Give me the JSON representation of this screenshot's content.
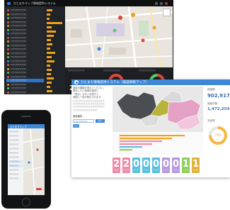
{
  "dashboard": {
    "title": "ひとまちマップ情報提供システム",
    "sidebar_items": [
      {
        "label": "○○○○○○○○",
        "color": "#e05a5a"
      },
      {
        "label": "○○○○○○○○",
        "color": "#f0a21d"
      },
      {
        "label": "○○○○○○○○",
        "color": "#5cc96a"
      },
      {
        "label": "○○○○○○○○",
        "color": "#e05a5a"
      },
      {
        "label": "○○○○○○○○",
        "color": "#f0a21d"
      },
      {
        "label": "○○○○○○○○",
        "color": "#5cc96a"
      },
      {
        "label": "○○○○○○○○",
        "color": "#3d86d8"
      },
      {
        "label": "○○○○○○○○",
        "color": "#e05a5a"
      },
      {
        "label": "○○○○○○○○",
        "color": "#f0a21d"
      },
      {
        "label": "○○○○○○○○",
        "color": "#5cc96a"
      },
      {
        "label": "○○○○○○○○",
        "color": "#e05a5a"
      },
      {
        "label": "○○○○○○○○",
        "color": "#f0a21d"
      },
      {
        "label": "○○○○○○○○",
        "color": "#5cc96a"
      },
      {
        "label": "○○○○○○○○",
        "color": "#3d86d8"
      },
      {
        "label": "○○○○○○○○",
        "color": "#e05a5a"
      },
      {
        "label": "○○○○○○○○",
        "color": "#f0a21d"
      },
      {
        "label": "○○○○○○○○",
        "color": "#5cc96a"
      },
      {
        "label": "○○○○○○○○",
        "color": "#e05a5a"
      },
      {
        "label": "○○○○○○○○",
        "color": "#3d86d8",
        "selected": true
      },
      {
        "label": "○○○○○○○○",
        "color": "#f0a21d"
      },
      {
        "label": "○○○○○○○○",
        "color": "#5cc96a"
      },
      {
        "label": "○○○○○○○○",
        "color": "#e05a5a"
      }
    ],
    "bar_values": [
      0.35,
      0.2,
      0.15,
      0.9,
      0.3,
      0.55,
      0.4,
      0.25,
      0.35,
      0.2,
      0.5,
      0.3,
      0.45,
      0.2,
      0.3,
      0.25,
      0.4,
      0.3,
      0.2,
      0.35
    ],
    "stat_labels": [
      "○○○○○○○○",
      "○○○○○○○○",
      "○○○○○○○○"
    ],
    "stat_value": "20"
  },
  "window": {
    "title": "ひとまち情報提供システム（施設情報マップ）",
    "intro_lines": [
      "施設の種類を選んでください。",
      "表示したい地域を選択し",
      "「表示」ボタンを押すと",
      "地図と一覧が表示されます。",
      "○○○○○○○○○○○○○○○○",
      "○○○○○○○○○○○○○○○○",
      "○○○○○○○○○○○○○○○○",
      "○○○○○○○○○○○○"
    ],
    "select_label": "施設種別",
    "select_value": "○○○○○○○",
    "search_button": "表示",
    "kpis": [
      {
        "label": "総面積",
        "value": "902,917"
      },
      {
        "label": "施設件数",
        "value": "1,472,254"
      }
    ],
    "donut_label": "充足率",
    "donut_value": "75%",
    "donut_fraction": 0.75,
    "tiles": [
      {
        "value": "2",
        "label": "○○○",
        "color": "#f08aa8"
      },
      {
        "value": "2",
        "label": "○○○",
        "color": "#f08aa8"
      },
      {
        "value": "0",
        "label": "○○○",
        "color": "#5bc0de"
      },
      {
        "value": "0",
        "label": "○○○",
        "color": "#5bc0de"
      },
      {
        "value": "0",
        "label": "○○○",
        "color": "#5bc0de"
      },
      {
        "value": "0",
        "label": "○○○",
        "color": "#b79ae0"
      },
      {
        "value": "0",
        "label": "○○○",
        "color": "#b79ae0"
      },
      {
        "value": "1",
        "label": "○○○",
        "color": "#8fcf5a"
      },
      {
        "value": "1",
        "label": "○○○",
        "color": "#e0b43c"
      }
    ]
  },
  "phone": {
    "title": "ひとまちマップ",
    "menu": [
      "○○○○○○",
      "○○○○○○",
      "○○○○○○",
      "○○○○○○",
      "○○○○○○",
      "○○○○○○",
      "○○○○○○",
      "○○○○○○",
      "○○○○○○",
      "○○○○○○",
      "○○○○○○",
      "○○○○○○"
    ]
  },
  "colors": {
    "accent": "#3d86d8",
    "bar": "#f0a21d",
    "dark": "#1d1f22"
  }
}
